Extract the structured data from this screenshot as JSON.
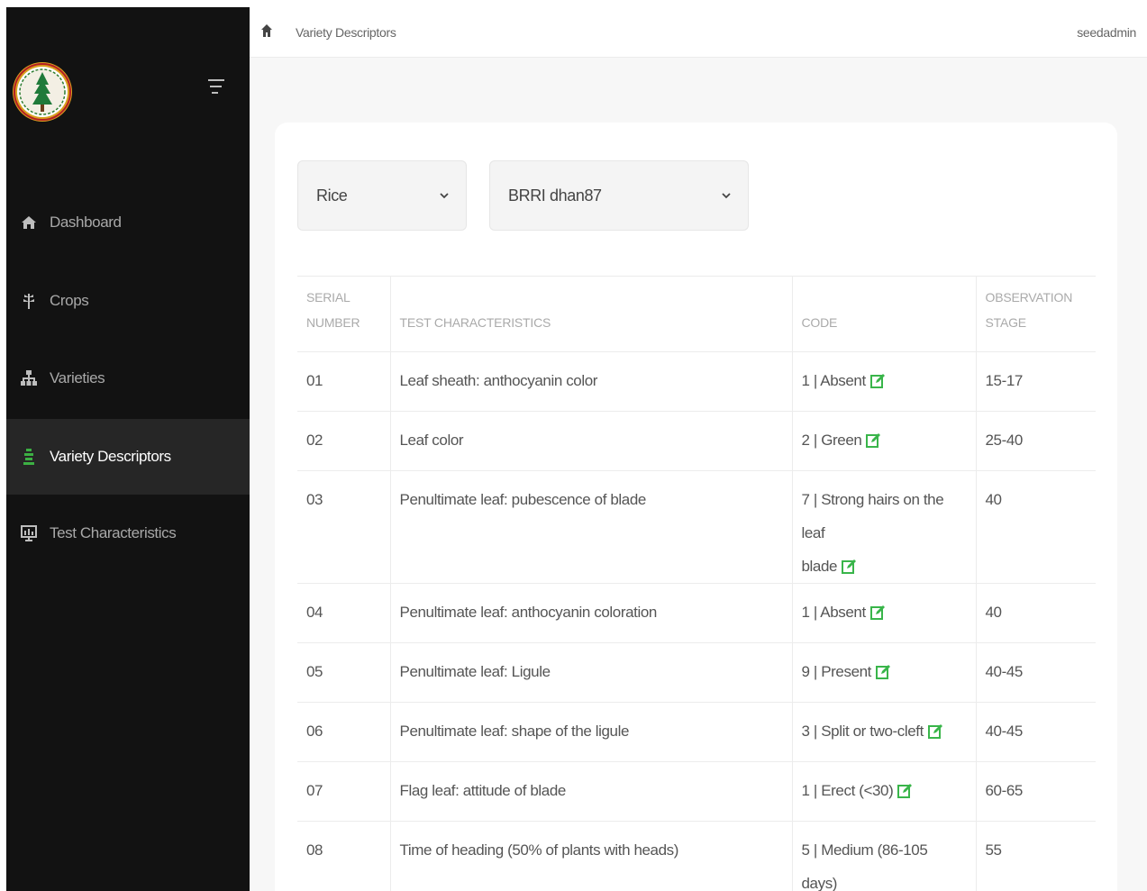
{
  "header": {
    "breadcrumb": "Variety Descriptors",
    "user": "seedadmin"
  },
  "sidebar": {
    "items": [
      {
        "label": "Dashboard",
        "icon": "home-icon"
      },
      {
        "label": "Crops",
        "icon": "plant-icon"
      },
      {
        "label": "Varieties",
        "icon": "sitemap-icon"
      },
      {
        "label": "Variety Descriptors",
        "icon": "list-icon",
        "active": true
      },
      {
        "label": "Test Characteristics",
        "icon": "chart-icon"
      }
    ]
  },
  "filters": {
    "crop": "Rice",
    "variety": "BRRI dhan87"
  },
  "table": {
    "headers": {
      "serial_1": "SERIAL",
      "serial_2": "NUMBER",
      "characteristics": "TEST CHARACTERISTICS",
      "code": "CODE",
      "stage_1": "OBSERVATION",
      "stage_2": "STAGE"
    },
    "rows": [
      {
        "serial": "01",
        "characteristic": "Leaf sheath: anthocyanin color",
        "code": "1 | Absent",
        "stage": "15-17"
      },
      {
        "serial": "02",
        "characteristic": "Leaf color",
        "code": "2 | Green",
        "stage": "25-40"
      },
      {
        "serial": "03",
        "characteristic": "Penultimate leaf: pubescence of blade",
        "code_1": "7 | Strong hairs on the leaf",
        "code_2": "blade",
        "stage": "40"
      },
      {
        "serial": "04",
        "characteristic": "Penultimate leaf: anthocyanin coloration",
        "code": "1 | Absent",
        "stage": "40"
      },
      {
        "serial": "05",
        "characteristic": "Penultimate leaf: Ligule",
        "code": "9 | Present",
        "stage": "40-45"
      },
      {
        "serial": "06",
        "characteristic": "Penultimate leaf: shape of the ligule",
        "code": "3 | Split or two-cleft",
        "stage": "40-45"
      },
      {
        "serial": "07",
        "characteristic": "Flag leaf: attitude of blade",
        "code": "1 | Erect (<30)",
        "stage": "60-65"
      },
      {
        "serial": "08",
        "characteristic": "Time of heading (50% of plants with heads)",
        "code": "5 | Medium (86-105 days)",
        "stage": "55"
      }
    ]
  },
  "colors": {
    "sidebar_bg": "#121212",
    "sidebar_active": "#262626",
    "accent_green": "#3cb043",
    "edit_icon": "#39b54a"
  }
}
